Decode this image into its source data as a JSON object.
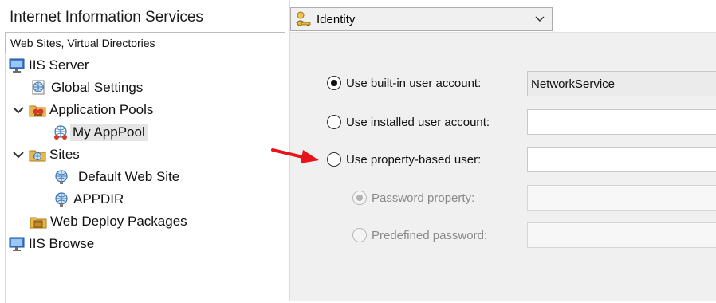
{
  "app": {
    "title": "Internet Information Services"
  },
  "tree": {
    "header": "Web Sites, Virtual Directories",
    "nodes": [
      {
        "label": "IIS Server",
        "icon": "monitor-icon"
      },
      {
        "label": "Global Settings",
        "icon": "globe-settings-icon"
      },
      {
        "label": "Application Pools",
        "icon": "app-pools-icon",
        "expanded": true
      },
      {
        "label": "My AppPool",
        "icon": "app-pool-icon",
        "selected": true
      },
      {
        "label": "Sites",
        "icon": "sites-folder-icon",
        "expanded": true
      },
      {
        "label": "Default Web Site",
        "icon": "web-site-icon"
      },
      {
        "label": "APPDIR",
        "icon": "web-site-icon"
      },
      {
        "label": "Web Deploy Packages",
        "icon": "package-icon"
      },
      {
        "label": "IIS Browse",
        "icon": "monitor-icon"
      }
    ]
  },
  "section_selector": {
    "value": "Identity",
    "icon": "identity-key-icon"
  },
  "identity": {
    "builtin": {
      "label": "Use built-in user account:",
      "selected": true,
      "value": "NetworkService"
    },
    "installed": {
      "label": "Use installed user account:",
      "selected": false,
      "value": ""
    },
    "property": {
      "label": "Use property-based user:",
      "selected": false,
      "value": ""
    },
    "password_property": {
      "label": "Password property:",
      "selected": true,
      "enabled": false,
      "value": ""
    },
    "predefined_password": {
      "label": "Predefined password:",
      "selected": false,
      "enabled": false,
      "value": ""
    }
  },
  "colors": {
    "annotation_arrow": "#e8141c",
    "panel_bg": "#f0f0f0",
    "selection_bg": "#e5e5e5"
  }
}
